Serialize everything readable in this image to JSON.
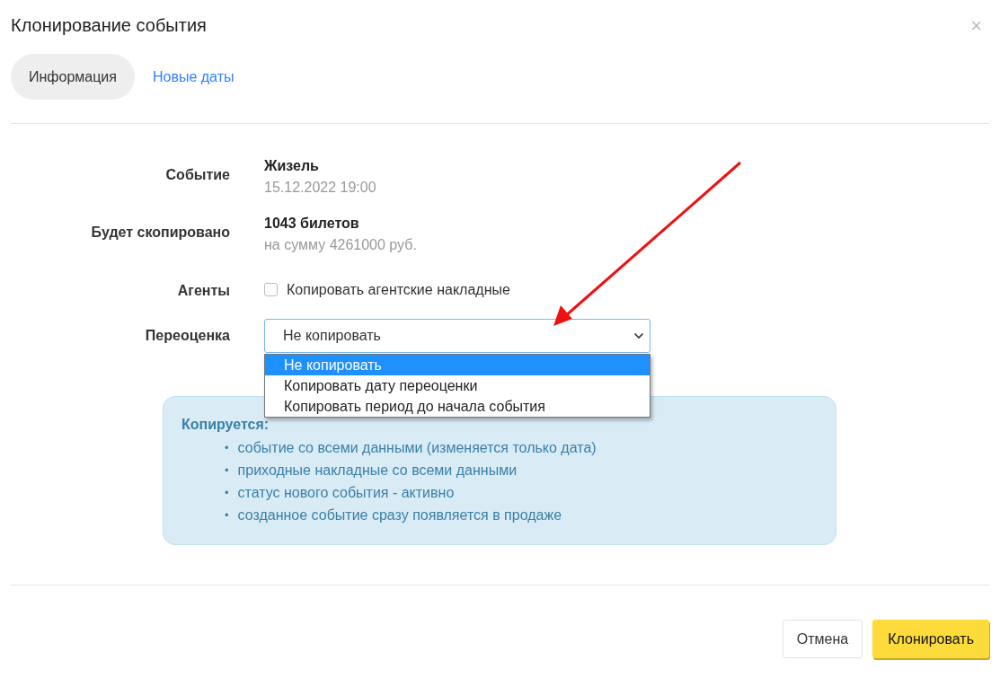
{
  "dialog": {
    "title": "Клонирование события",
    "close": "×"
  },
  "tabs": [
    {
      "label": "Информация",
      "selected": true
    },
    {
      "label": "Новые даты",
      "selected": false
    }
  ],
  "form": {
    "event": {
      "label": "Событие",
      "name": "Жизель",
      "date": "15.12.2022 19:00"
    },
    "copied": {
      "label": "Будет скопировано",
      "count": "1043 билетов",
      "sum": "на сумму 4261000 руб."
    },
    "agents": {
      "label": "Агенты",
      "checkbox": "Копировать агентские накладные",
      "checked": false
    },
    "revaluation": {
      "label": "Переоценка",
      "value": "Не копировать",
      "expanded": true,
      "options": [
        {
          "label": "Не копировать",
          "selected": true
        },
        {
          "label": "Копировать дату переоценки",
          "selected": false
        },
        {
          "label": "Копировать период до начала события",
          "selected": false
        }
      ]
    }
  },
  "info": {
    "title": "Копируется:",
    "items": [
      {
        "marker": "•",
        "text": "событие со всеми данными (изменяется только дата)"
      },
      {
        "marker": "•",
        "text": "приходные накладные со всеми данными"
      },
      {
        "marker": "•",
        "text": "статус нового события - активно"
      },
      {
        "marker": "•",
        "text": "созданное событие сразу появляется в продаже"
      }
    ]
  },
  "buttons": {
    "cancel": "Отмена",
    "submit": "Клонировать"
  }
}
